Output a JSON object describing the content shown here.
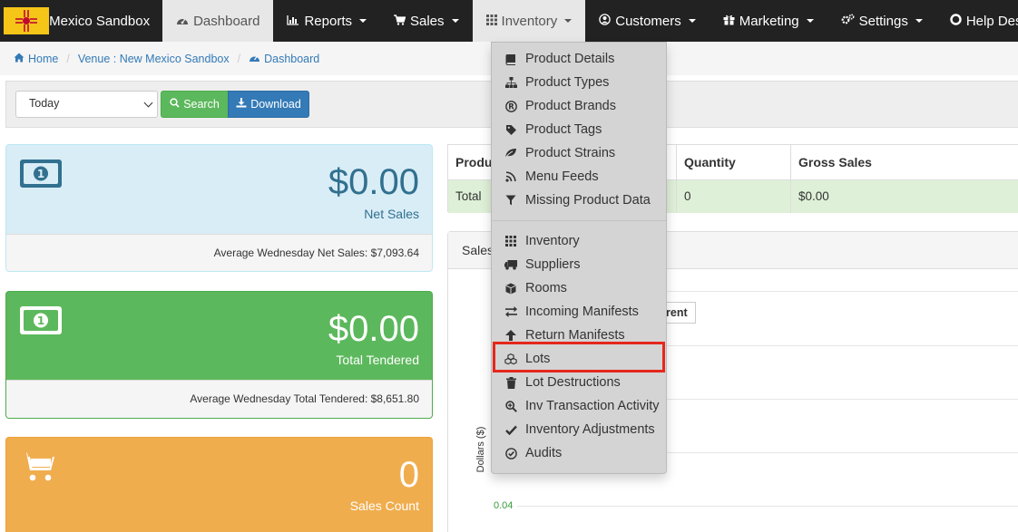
{
  "navbar": {
    "brand": "New Mexico Sandbox",
    "items": [
      {
        "label": "Dashboard",
        "icon": "dashboard-icon"
      },
      {
        "label": "Reports",
        "icon": "bar-chart-icon"
      },
      {
        "label": "Sales",
        "icon": "cart-icon"
      },
      {
        "label": "Inventory",
        "icon": "grid-icon"
      },
      {
        "label": "Customers",
        "icon": "user-circle-icon"
      },
      {
        "label": "Marketing",
        "icon": "gift-icon"
      },
      {
        "label": "Settings",
        "icon": "gears-icon"
      },
      {
        "label": "Help Desk",
        "icon": "life-ring-icon"
      }
    ]
  },
  "breadcrumb": {
    "home": "Home",
    "venue": "Venue : New Mexico Sandbox",
    "current": "Dashboard"
  },
  "filter": {
    "range_value": "Today",
    "search_label": "Search",
    "download_label": "Download"
  },
  "stats": {
    "net_sales": {
      "amount": "$0.00",
      "caption": "Net Sales",
      "footer": "Average Wednesday Net Sales: $7,093.64"
    },
    "total_tendered": {
      "amount": "$0.00",
      "caption": "Total Tendered",
      "footer": "Average Wednesday Total Tendered: $8,651.80"
    },
    "sales_count": {
      "amount": "0",
      "caption": "Sales Count"
    }
  },
  "sales_table": {
    "headers": {
      "product": "Produ",
      "quantity": "Quantity",
      "gross_sales": "Gross Sales"
    },
    "total_row": {
      "label": "Total",
      "quantity": "0",
      "gross_sales": "$0.00"
    }
  },
  "chart": {
    "title": "Sales",
    "legend_partial": "rent",
    "ylabel": "Dollars ($)",
    "tick": "0.04"
  },
  "inventory_menu": {
    "group1": [
      {
        "label": "Product Details",
        "icon": "book-icon"
      },
      {
        "label": "Product Types",
        "icon": "sitemap-icon"
      },
      {
        "label": "Product Brands",
        "icon": "registered-icon"
      },
      {
        "label": "Product Tags",
        "icon": "tag-icon"
      },
      {
        "label": "Product Strains",
        "icon": "leaf-icon"
      },
      {
        "label": "Menu Feeds",
        "icon": "rss-icon"
      },
      {
        "label": "Missing Product Data",
        "icon": "filter-icon"
      }
    ],
    "group2": [
      {
        "label": "Inventory",
        "icon": "grid-icon"
      },
      {
        "label": "Suppliers",
        "icon": "truck-icon"
      },
      {
        "label": "Rooms",
        "icon": "cube-icon"
      },
      {
        "label": "Incoming Manifests",
        "icon": "exchange-icon"
      },
      {
        "label": "Return Manifests",
        "icon": "arrow-up-icon"
      },
      {
        "label": "Lots",
        "icon": "cubes-icon"
      },
      {
        "label": "Lot Destructions",
        "icon": "trash-icon"
      },
      {
        "label": "Inv Transaction Activity",
        "icon": "search-plus-icon"
      },
      {
        "label": "Inventory Adjustments",
        "icon": "check-icon"
      },
      {
        "label": "Audits",
        "icon": "check-circle-icon"
      }
    ]
  },
  "colors": {
    "navbar": "#222222",
    "highlight": "#e5271c",
    "net_sales_panel": "#d9edf7",
    "tendered_panel": "#5cb85c",
    "count_panel": "#f0ad4e",
    "search_button": "#5cb85c",
    "download_button": "#337ab7"
  }
}
